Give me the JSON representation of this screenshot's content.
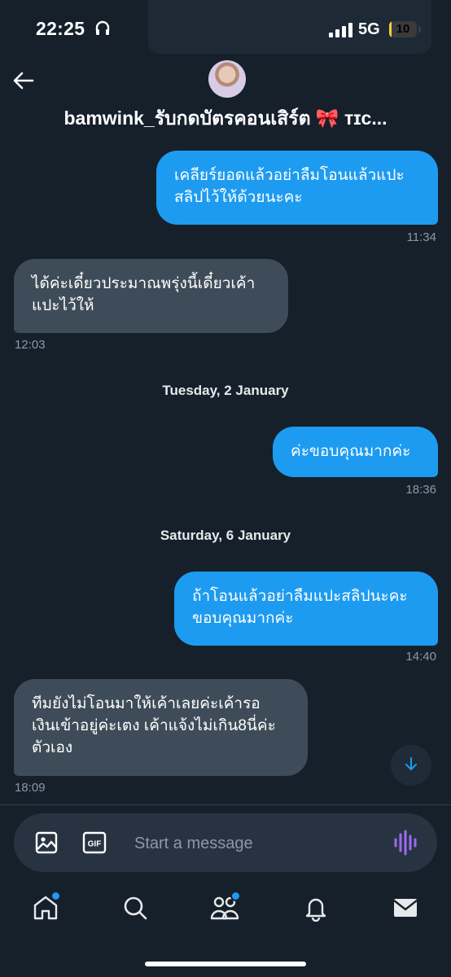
{
  "status_bar": {
    "time": "22:25",
    "network": "5G",
    "battery": "10",
    "battery_level": 0.1
  },
  "header": {
    "title": "bamwink_รับกดบัตรคอนเสิร์ต 🎀 ᴛɪᴄ..."
  },
  "messages": [
    {
      "direction": "sent",
      "text": "เคลียร์ยอดแล้วอย่าลืมโอนแล้วแปะ\nสลิปไว้ให้ด้วยนะคะ",
      "time": "11:34"
    },
    {
      "direction": "received",
      "text": "ได้ค่ะเดี๋ยวประมาณพรุ่งนี้เดี๋ยวเค้า\nแปะไว้ให้",
      "time": "12:03"
    },
    {
      "direction": "sent",
      "text": "ค่ะขอบคุณมากค่ะ",
      "time": "18:36"
    },
    {
      "direction": "sent",
      "text": "ถ้าโอนแล้วอย่าลืมแปะสลิปนะคะ\nขอบคุณมากค่ะ",
      "time": "14:40"
    },
    {
      "direction": "received",
      "text": "ทีมยังไม่โอนมาให้เค้าเลยค่ะเค้ารอ\nเงินเข้าอยู่ค่ะเตง เค้าแจ้งไม่เกิน8นี่ค่ะ\nตัวเอง",
      "time": "18:09"
    }
  ],
  "date_separators": [
    "Tuesday, 2 January",
    "Saturday, 6 January"
  ],
  "composer": {
    "placeholder": "Start a message",
    "gif_label": "GIF"
  },
  "nav": {
    "items": [
      "home-icon",
      "search-icon",
      "communities-icon",
      "notifications-icon",
      "messages-icon"
    ]
  },
  "colors": {
    "background": "#15202b",
    "sent_bubble": "#1d9bf0",
    "received_bubble": "#3e4c59",
    "accent": "#1d9bf0",
    "voice": "#9b6bf2"
  }
}
